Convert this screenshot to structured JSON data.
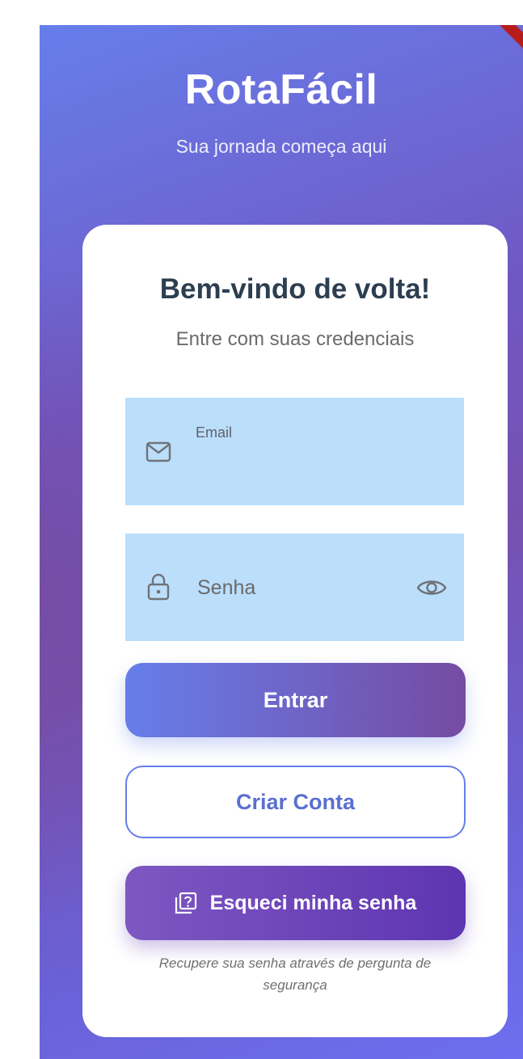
{
  "brand": {
    "title": "RotaFácil",
    "subtitle": "Sua jornada começa aqui"
  },
  "card": {
    "title": "Bem-vindo de volta!",
    "subtitle": "Entre com suas credenciais"
  },
  "email_field": {
    "label": "Email",
    "value": "",
    "icon": "envelope-icon"
  },
  "password_field": {
    "placeholder": "Senha",
    "value": "",
    "icon": "lock-icon",
    "toggle_icon": "eye-icon"
  },
  "buttons": {
    "login_label": "Entrar",
    "create_account_label": "Criar Conta",
    "forgot_password_label": "Esqueci minha senha",
    "forgot_password_icon": "help-box-icon"
  },
  "forgot_hint": "Recupere sua senha através de pergunta de segurança",
  "colors": {
    "gradient_start": "#667eea",
    "gradient_end": "#764ba2",
    "field_fill": "#bbdefb",
    "forgot_button": "#5e35b1",
    "heading_text": "#2c3e50"
  }
}
